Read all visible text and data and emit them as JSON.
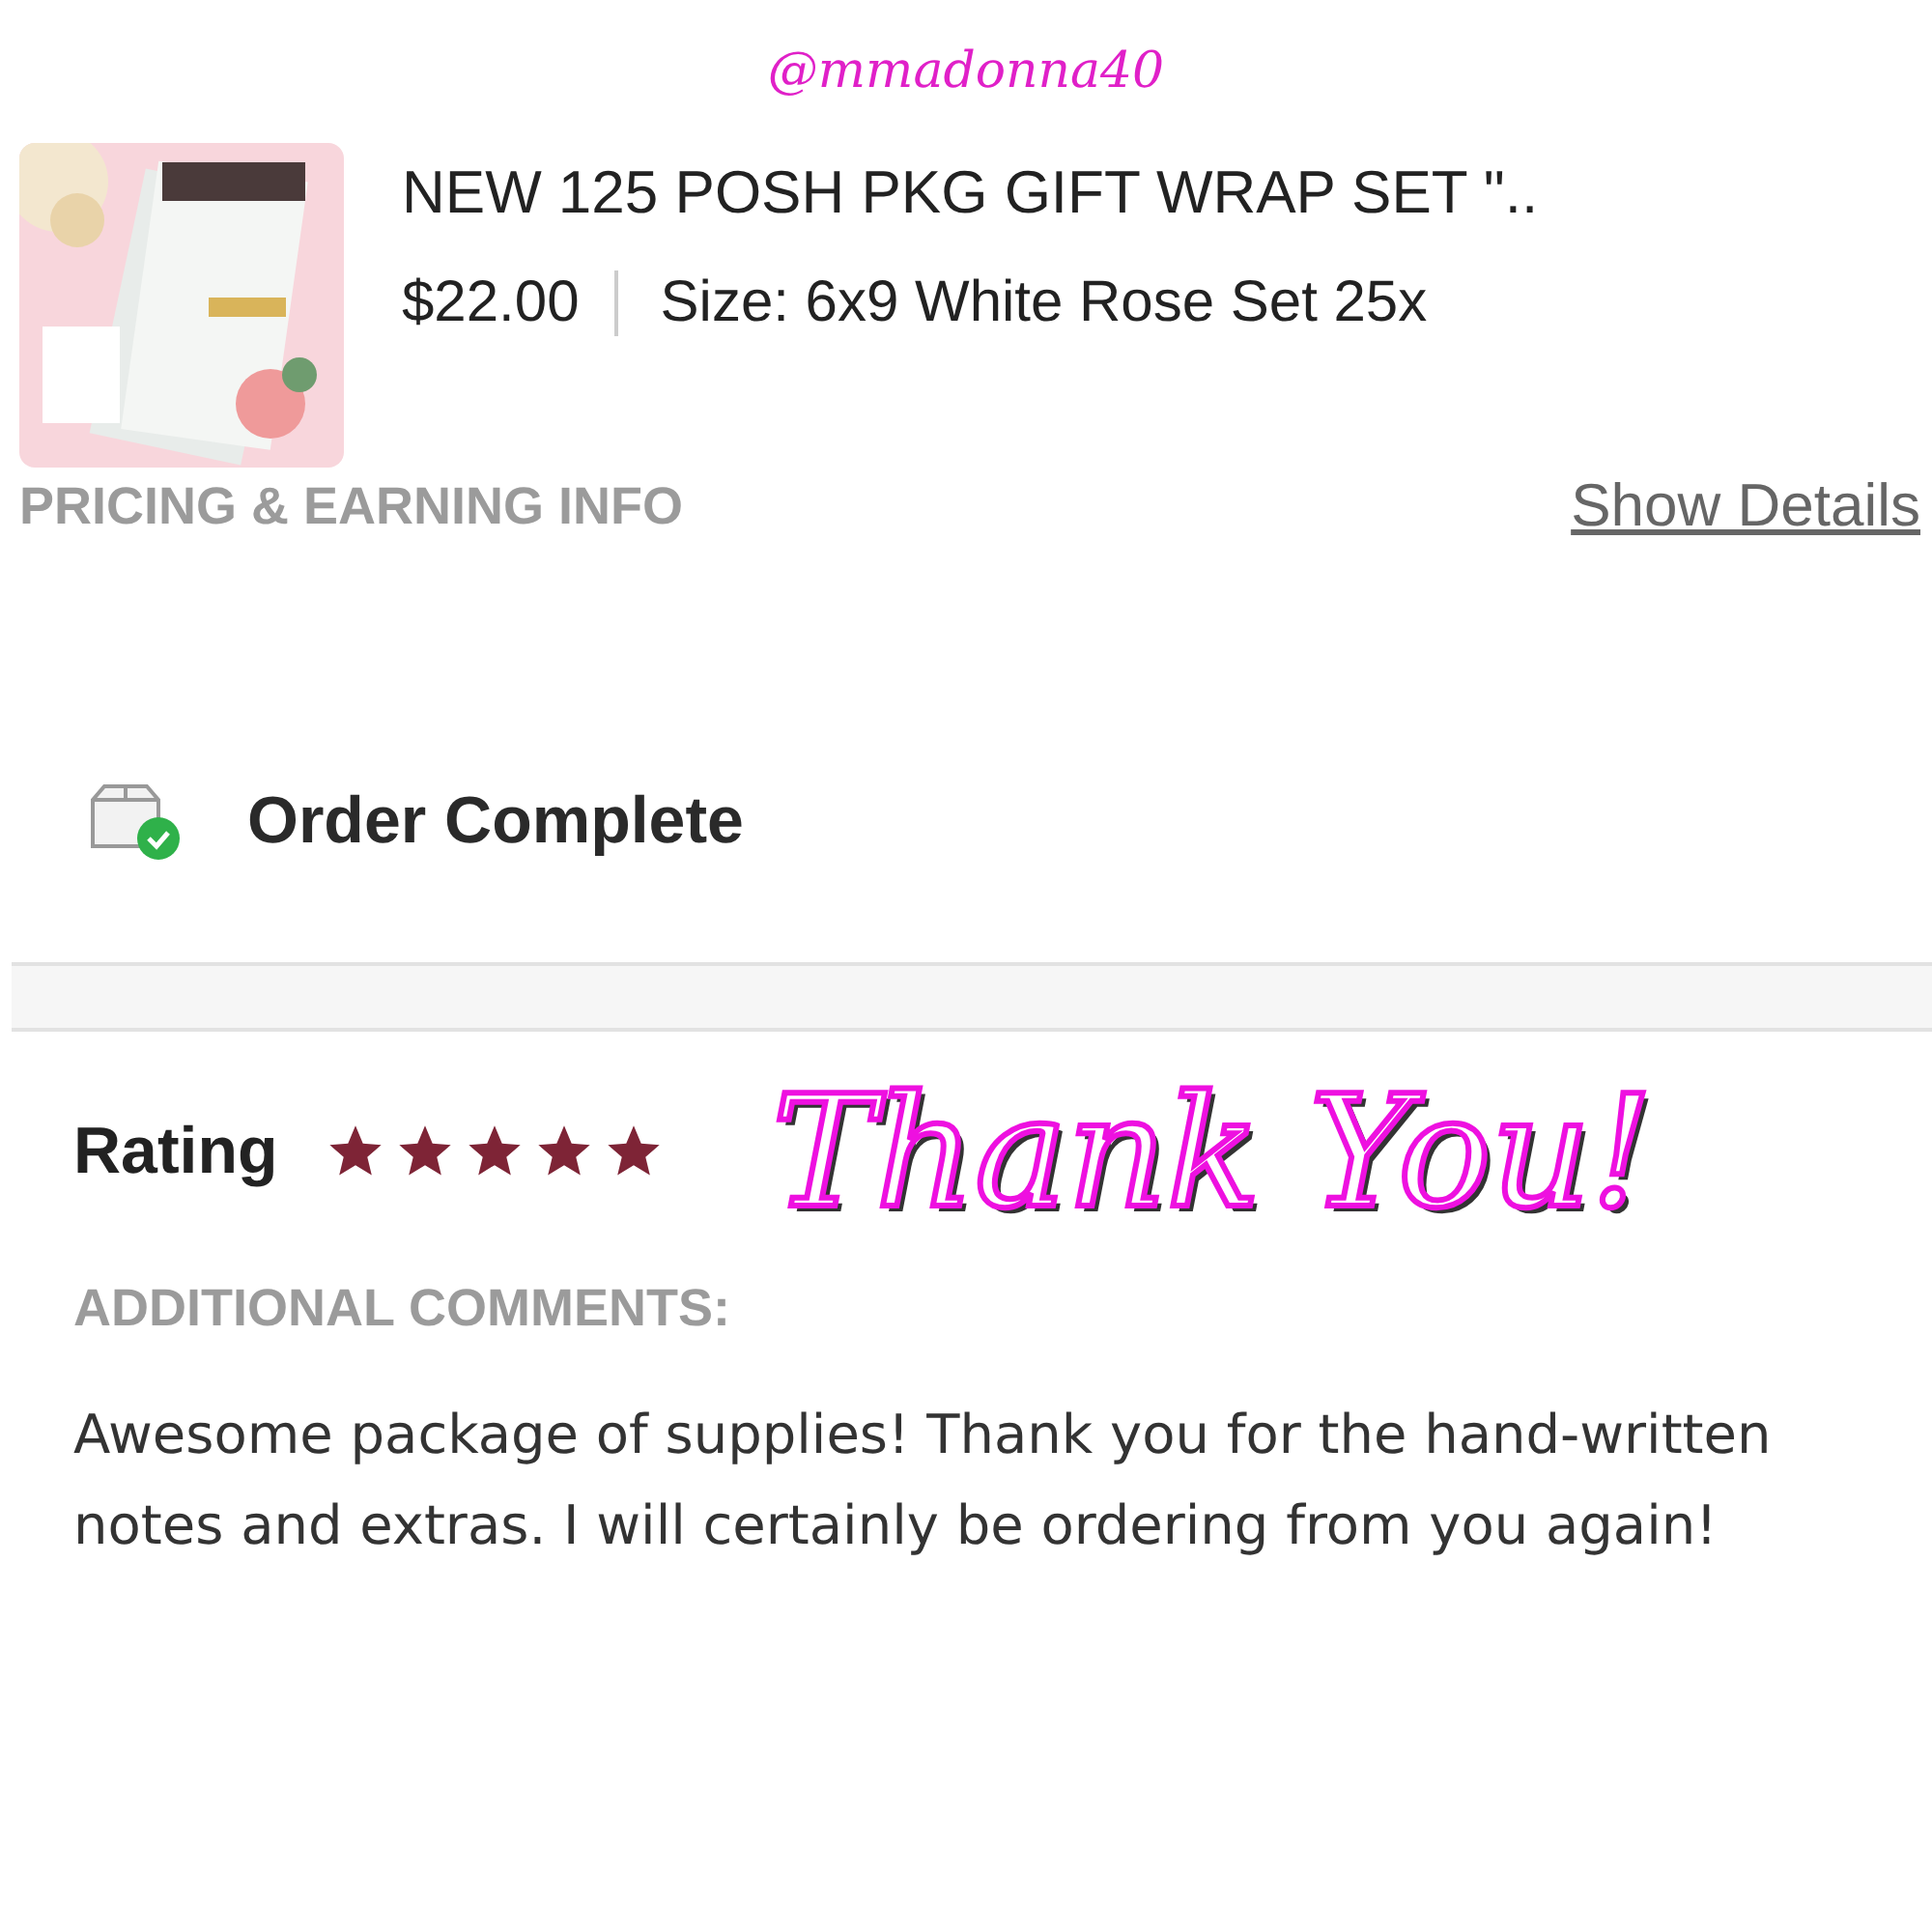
{
  "handle": "@mmadonna40",
  "product": {
    "title": "NEW 125 POSH PKG GIFT WRAP SET \"..",
    "price": "$22.00",
    "size": "Size: 6x9 White Rose Set 25x"
  },
  "pricing": {
    "label": "PRICING & EARNING INFO",
    "link": "Show Details"
  },
  "status": {
    "label": "Order Complete"
  },
  "rating": {
    "label": "Rating",
    "stars": 5,
    "overlay": "Thank You!"
  },
  "comments": {
    "label": "ADDITIONAL COMMENTS:",
    "text": "Awesome package of supplies! Thank you for the hand-written notes and extras. I will certainly be ordering from you again!"
  }
}
